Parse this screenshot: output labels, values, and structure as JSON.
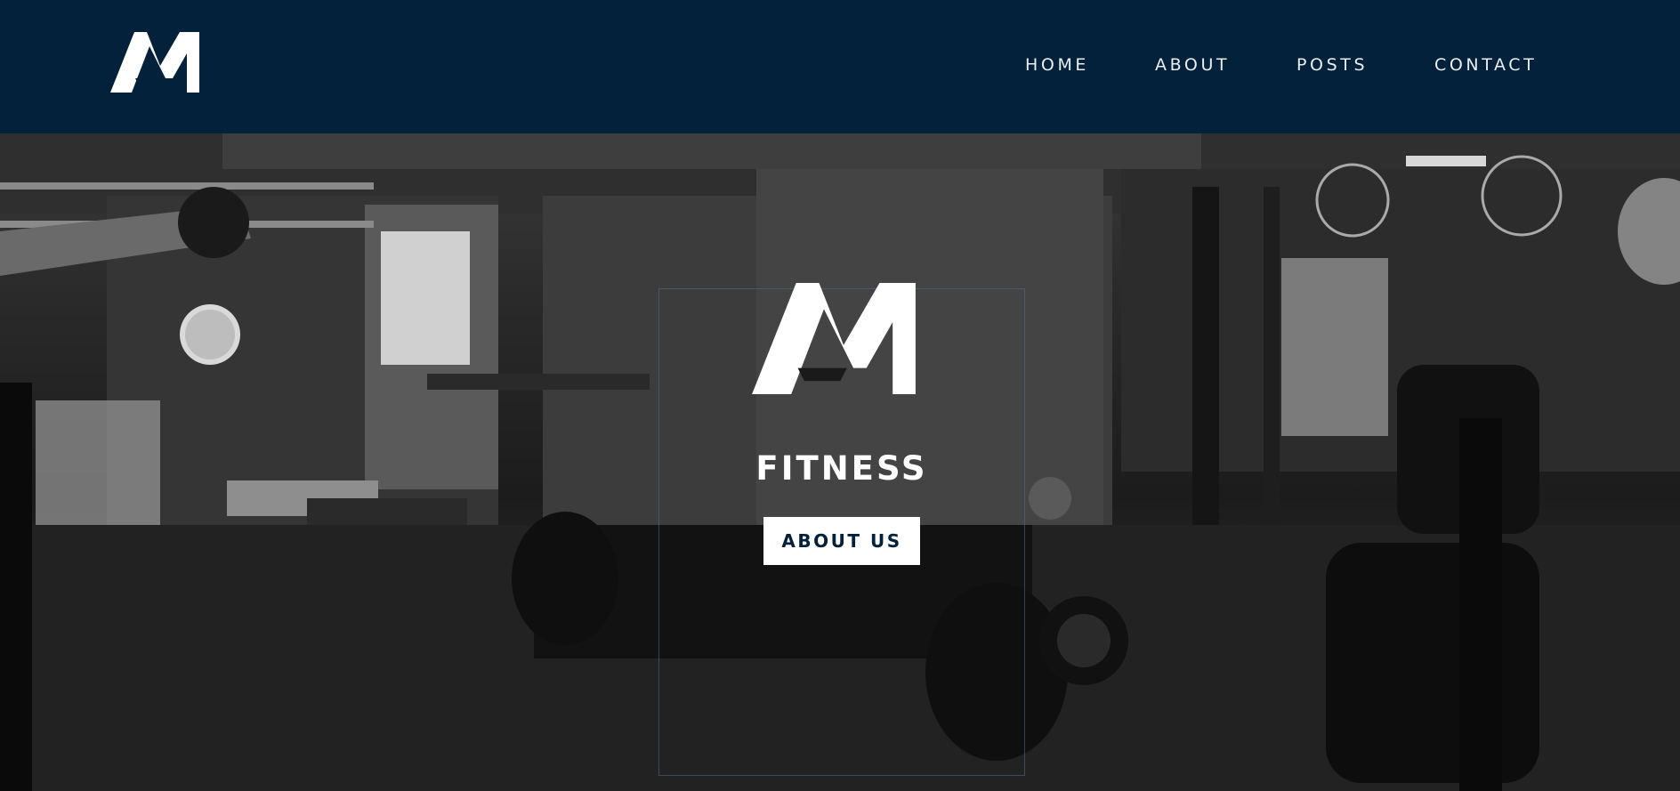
{
  "brand": {
    "logo_icon": "am-logo-icon",
    "colors": {
      "header_bg": "#03213a",
      "logo": "#ffffff",
      "nav_text": "#e9eef3"
    }
  },
  "nav": {
    "items": [
      {
        "label": "HOME"
      },
      {
        "label": "ABOUT"
      },
      {
        "label": "POSTS"
      },
      {
        "label": "CONTACT"
      }
    ]
  },
  "hero": {
    "background": "black-and-white gym interior photo",
    "title": "FITNESS",
    "button_label": "ABOUT US",
    "colors": {
      "button_bg": "#ffffff",
      "button_text": "#03213a",
      "title": "#ffffff"
    }
  }
}
